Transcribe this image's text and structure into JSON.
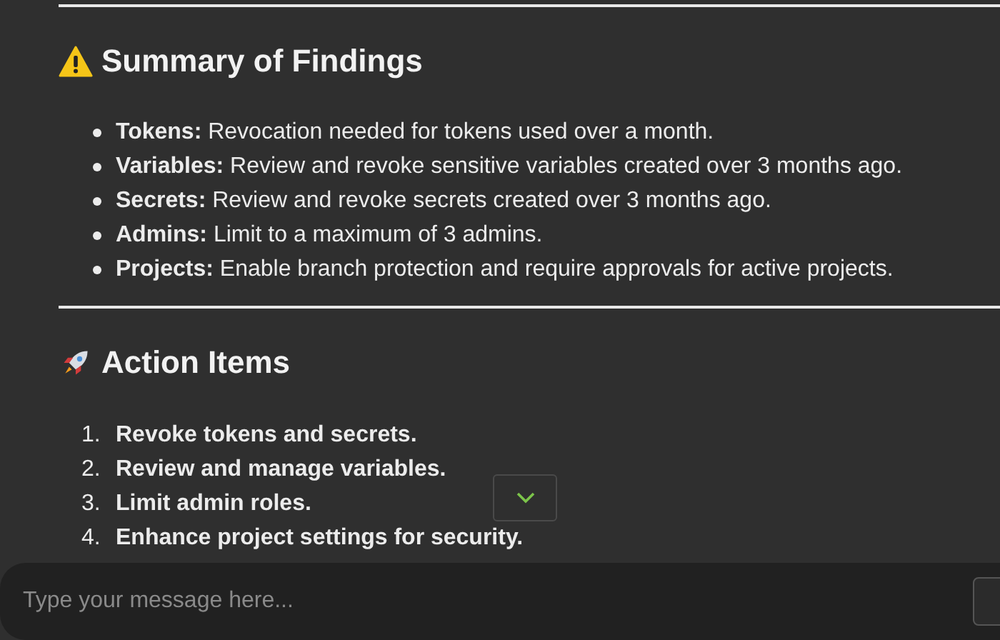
{
  "summary": {
    "title": "Summary of Findings",
    "items": [
      {
        "label": "Tokens:",
        "text": "Revocation needed for tokens used over a month."
      },
      {
        "label": "Variables:",
        "text": "Review and revoke sensitive variables created over 3 months ago."
      },
      {
        "label": "Secrets:",
        "text": "Review and revoke secrets created over 3 months ago."
      },
      {
        "label": "Admins:",
        "text": "Limit to a maximum of 3 admins."
      },
      {
        "label": "Projects:",
        "text": "Enable branch protection and require approvals for active projects."
      }
    ]
  },
  "actions": {
    "title": "Action Items",
    "items": [
      {
        "number": "1.",
        "text": "Revoke tokens and secrets."
      },
      {
        "number": "2.",
        "text": "Review and manage variables."
      },
      {
        "number": "3.",
        "text": "Limit admin roles."
      },
      {
        "number": "4.",
        "text": "Enhance project settings for security."
      }
    ]
  },
  "composer": {
    "placeholder": "Type your message here..."
  }
}
